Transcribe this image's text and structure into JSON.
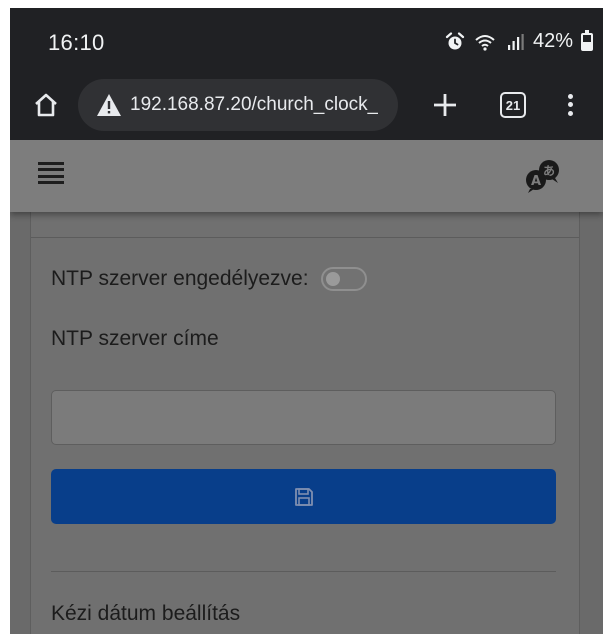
{
  "status_bar": {
    "time": "16:10",
    "battery": "42%",
    "icons": [
      "alarm-icon",
      "wifi-icon",
      "signal-icon",
      "battery-icon"
    ]
  },
  "browser": {
    "url": "192.168.87.20/church_clock_",
    "tab_count": "21",
    "icons": [
      "home-icon",
      "warning-icon",
      "plus-icon",
      "tab-switcher-icon",
      "more-vert-icon"
    ]
  },
  "navbar": {
    "icons": [
      "menu-icon",
      "translate-icon"
    ]
  },
  "settings": {
    "ntp_enabled_label": "NTP szerver engedélyezve:",
    "ntp_enabled": false,
    "ntp_address_label": "NTP szerver címe",
    "ntp_address_value": "",
    "save_icon": "save-icon",
    "manual_date_label": "Kézi dátum beállítás"
  },
  "colors": {
    "chrome_bg": "#202124",
    "page_overlay": "#6a6a6a",
    "primary_button": "#083e8a"
  }
}
